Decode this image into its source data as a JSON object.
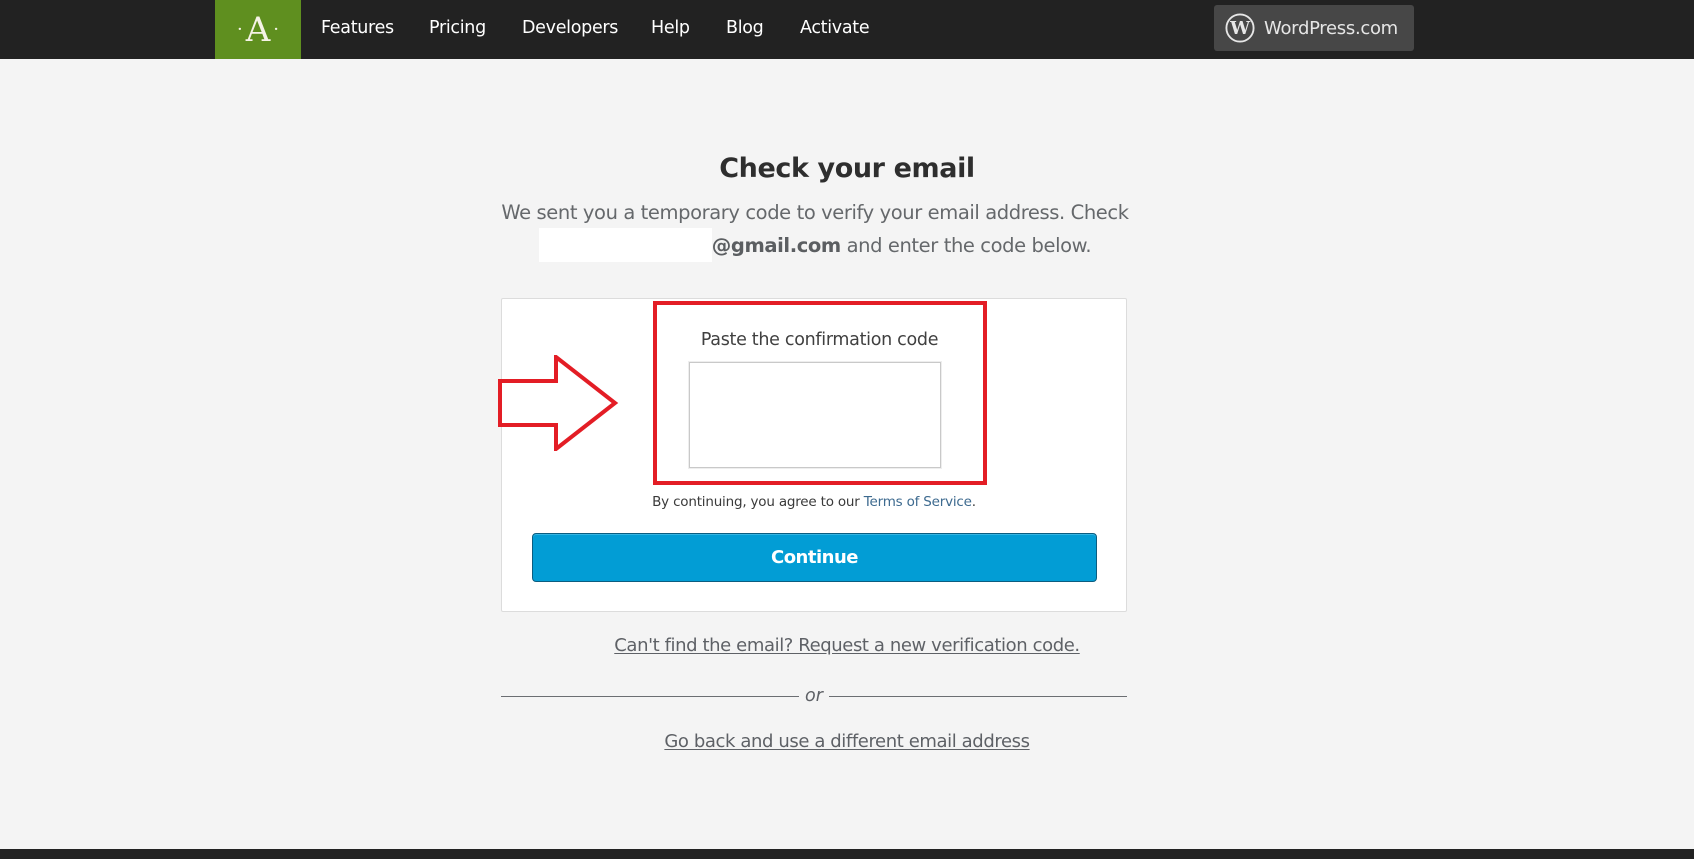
{
  "header": {
    "logo_letter": "A",
    "logo_dot": "·",
    "nav": [
      {
        "label": "Features"
      },
      {
        "label": "Pricing"
      },
      {
        "label": "Developers"
      },
      {
        "label": "Help"
      },
      {
        "label": "Blog"
      },
      {
        "label": "Activate"
      }
    ],
    "wordpress_button": {
      "label": "WordPress.com",
      "icon": "wordpress-logo-icon"
    }
  },
  "main": {
    "title": "Check your email",
    "subtitle_line1": "We sent you a temporary code to verify your email address. Check",
    "email_domain": "@gmail.com",
    "subtitle_line2_suffix": " and enter the code below.",
    "code_label": "Paste the confirmation code",
    "code_value": "",
    "terms_prefix": "By continuing, you agree to our ",
    "terms_link": "Terms of Service",
    "terms_suffix": ".",
    "continue_label": "Continue",
    "resend_link": "Can't find the email? Request a new verification code.",
    "divider_label": "or",
    "back_link": "Go back and use a different email address"
  },
  "annotation": {
    "highlight_color": "#e31d25",
    "arrow_icon": "right-arrow-icon"
  },
  "colors": {
    "brand_green": "#5f8f1f",
    "button_blue": "#029dd5",
    "topbar": "#222222"
  }
}
